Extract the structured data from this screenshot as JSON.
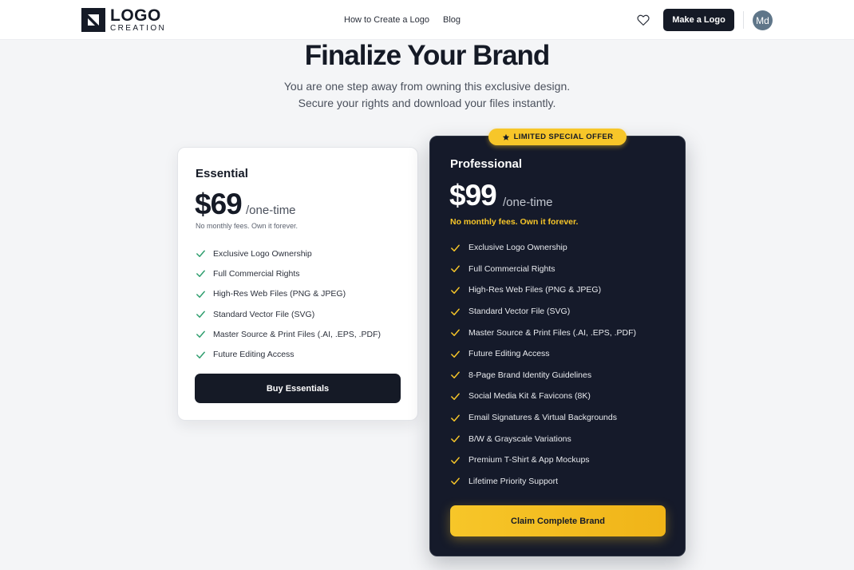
{
  "header": {
    "logo_word": "LOGO",
    "logo_sub": "CREATION",
    "nav": [
      {
        "label": "How to Create a Logo"
      },
      {
        "label": "Blog"
      }
    ],
    "favorites_icon": "heart-icon",
    "cta_label": "Make a Logo",
    "avatar_initials": "Md"
  },
  "hero": {
    "title": "Finalize Your Brand",
    "subtitle_line1": "You are one step away from owning this exclusive design.",
    "subtitle_line2": "Secure your rights and download your files instantly."
  },
  "plans": {
    "essential": {
      "name": "Essential",
      "price": "$69",
      "period": "/one-time",
      "note": "No monthly fees. Own it forever.",
      "features": [
        "Exclusive Logo Ownership",
        "Full Commercial Rights",
        "High-Res Web Files (PNG & JPEG)",
        "Standard Vector File (SVG)",
        "Master Source & Print Files (.AI, .EPS, .PDF)",
        "Future Editing Access"
      ],
      "button_label": "Buy Essentials",
      "check_color": "#2f9e6e"
    },
    "professional": {
      "badge": "LIMITED SPECIAL OFFER",
      "name": "Professional",
      "price": "$99",
      "period": "/one-time",
      "note": "No monthly fees. Own it forever.",
      "features": [
        "Exclusive Logo Ownership",
        "Full Commercial Rights",
        "High-Res Web Files (PNG & JPEG)",
        "Standard Vector File (SVG)",
        "Master Source & Print Files (.AI, .EPS, .PDF)",
        "Future Editing Access",
        "8-Page Brand Identity Guidelines",
        "Social Media Kit & Favicons (8K)",
        "Email Signatures & Virtual Backgrounds",
        "B/W & Grayscale Variations",
        "Premium T-Shirt & App Mockups",
        "Lifetime Priority Support"
      ],
      "button_label": "Claim Complete Brand",
      "accent_color": "#f7c629"
    }
  },
  "colors": {
    "dark": "#151a26",
    "background": "#f4f5f7",
    "accent": "#f7c629"
  }
}
